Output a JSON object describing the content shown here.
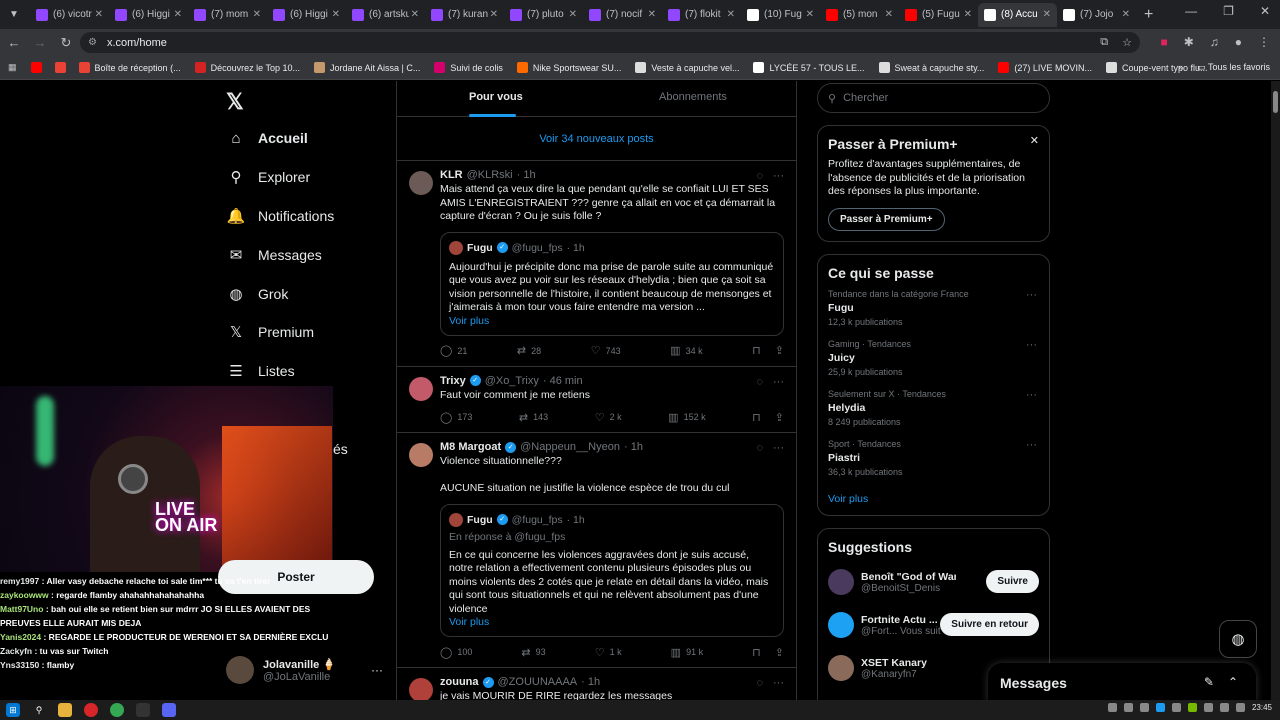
{
  "browser": {
    "tabs": [
      {
        "label": "(6) vicotr",
        "color": "#9147ff"
      },
      {
        "label": "(6) Higgi",
        "color": "#9147ff"
      },
      {
        "label": "(7) mom",
        "color": "#9147ff"
      },
      {
        "label": "(6) Higgi",
        "color": "#9147ff"
      },
      {
        "label": "(6) artsku",
        "color": "#9147ff"
      },
      {
        "label": "(7) kuran",
        "color": "#9147ff"
      },
      {
        "label": "(7) pluto",
        "color": "#9147ff"
      },
      {
        "label": "(7) nocif",
        "color": "#9147ff"
      },
      {
        "label": "(7) flokit",
        "color": "#9147ff"
      },
      {
        "label": "(10) Fug",
        "color": "#ffffff"
      },
      {
        "label": "(5) mon",
        "color": "#ff0000"
      },
      {
        "label": "(5) Fugu",
        "color": "#ff0000"
      },
      {
        "label": "(8) Accu",
        "color": "#ffffff"
      },
      {
        "label": "(7) Jojo",
        "color": "#ffffff"
      }
    ],
    "active_tab_index": 12,
    "url": "x.com/home",
    "bookmarks": [
      {
        "label": "",
        "color": "#ff0000"
      },
      {
        "label": "",
        "color": "#ea4335"
      },
      {
        "label": "Boîte de réception (...",
        "color": "#ea4335"
      },
      {
        "label": "Découvrez le Top 10...",
        "color": "#d32323"
      },
      {
        "label": "Jordane Ait Aissa | C...",
        "color": "#c49a6c"
      },
      {
        "label": "Suivi de colis",
        "color": "#d6006d"
      },
      {
        "label": "Nike Sportswear SU...",
        "color": "#ff6a00"
      },
      {
        "label": "Veste à capuche vel...",
        "color": "#dddddd"
      },
      {
        "label": "LYCÉE 57 - TOUS LE...",
        "color": "#ffffff"
      },
      {
        "label": "Sweat à capuche sty...",
        "color": "#dddddd"
      },
      {
        "label": "(27)  LIVE MOVIN...",
        "color": "#ff0000"
      },
      {
        "label": "Coupe-vent typo flu...",
        "color": "#dddddd"
      }
    ],
    "all_bookmarks": "Tous les favoris"
  },
  "leftnav": {
    "logo": "𝕏",
    "items": [
      {
        "label": "Accueil",
        "icon": "⌂"
      },
      {
        "label": "Explorer",
        "icon": "⚲"
      },
      {
        "label": "Notifications",
        "icon": "🔔"
      },
      {
        "label": "Messages",
        "icon": "✉"
      },
      {
        "label": "Grok",
        "icon": "◍"
      },
      {
        "label": "Premium",
        "icon": "𝕏"
      },
      {
        "label": "Listes",
        "icon": "☰"
      }
    ],
    "partial_label": "és",
    "post_button": "Poster",
    "profile": {
      "name": "Jolavanille 🍦",
      "handle": "@JoLaVanille"
    }
  },
  "stream_chat": [
    {
      "user": "remy1997",
      "color": "#e7e9ea",
      "msg": " : Aller vasy debache relache toi sale tim*** tu va t'en tirer"
    },
    {
      "user": "zaykoowww",
      "color": "#a9e37a",
      "msg": " : regarde flamby ahahahhahahahahha"
    },
    {
      "user": "Matt97Uno",
      "color": "#a9e37a",
      "msg": " : bah oui elle se retient bien sur mdrrr JO SI ELLES AVAIENT DES"
    },
    {
      "user": "",
      "color": "#fff",
      "msg": "PREUVES ELLE AURAIT MIS DEJA"
    },
    {
      "user": "Yanis2024",
      "color": "#a9e37a",
      "msg": " : REGARDE LE PRODUCTEUR DE WERENOI ET SA DERNIÈRE EXCLU"
    },
    {
      "user": "Zackyfn",
      "color": "#e7e9ea",
      "msg": " : tu vas sur Twitch"
    },
    {
      "user": "Yns33150",
      "color": "#e7e9ea",
      "msg": " : flamby"
    }
  ],
  "timeline": {
    "tabs": [
      "Pour vous",
      "Abonnements"
    ],
    "new_posts": "Voir 34 nouveaux posts",
    "tweets": [
      {
        "name": "KLR",
        "handle": "@KLRski",
        "time": "· 1h",
        "verified": false,
        "avatar_color": "#6b5a55",
        "text": "Mais attend ça veux dire la que pendant qu'elle se confiait LUI ET SES AMIS L'ENREGISTRAIENT ??? genre ça allait en voc et ça démarrait la capture d'écran ? Ou je suis folle ?",
        "quote": {
          "name": "Fugu",
          "handle": "@fugu_fps",
          "time": "· 1h",
          "reply_to": "",
          "text": "Aujourd'hui je précipite donc ma prise de parole suite au communiqué que vous avez pu voir sur les réseaux d'helydia ; bien que ça soit sa vision personnelle de l'histoire, il contient beaucoup de mensonges et j'aimerais à mon tour vous faire entendre ma version ...",
          "more": "Voir plus"
        },
        "stats": {
          "replies": "21",
          "reposts": "28",
          "likes": "743",
          "views": "34 k"
        }
      },
      {
        "name": "Trixy",
        "handle": "@Xo_Trixy",
        "time": "· 46 min",
        "verified": true,
        "avatar_color": "#c25a6a",
        "text": "Faut voir comment je me retiens",
        "stats": {
          "replies": "173",
          "reposts": "143",
          "likes": "2 k",
          "views": "152 k"
        }
      },
      {
        "name": "M8 Margoat",
        "handle": "@Nappeun__Nyeon",
        "time": "· 1h",
        "verified": true,
        "avatar_color": "#b87c66",
        "text": "Violence situationnelle???\n\nAUCUNE situation ne justifie la violence espèce de trou du cul",
        "quote": {
          "name": "Fugu",
          "handle": "@fugu_fps",
          "time": "· 1h",
          "reply_to": "En réponse à @fugu_fps",
          "text": "En ce qui concerne les violences aggravées dont je suis accusé, notre relation a effectivement contenu plusieurs épisodes plus ou moins violents des 2 cotés que je relate en détail dans la vidéo, mais qui sont tous situationnels et qui ne relèvent absolument pas d'une violence",
          "more": "Voir plus"
        },
        "stats": {
          "replies": "100",
          "reposts": "93",
          "likes": "1 k",
          "views": "91 k"
        }
      },
      {
        "name": "zouuna",
        "handle": "@ZOUUNAAAA",
        "time": "· 1h",
        "verified": true,
        "avatar_color": "#b0403a",
        "text": "je vais MOURIR DE RIRE regardez les messages"
      }
    ]
  },
  "rightcol": {
    "search_placeholder": "Chercher",
    "premium": {
      "title": "Passer à Premium+",
      "text": "Profitez d'avantages supplémentaires, de l'absence de publicités et de la priorisation des réponses la plus importante.",
      "button": "Passer à Premium+"
    },
    "happening": {
      "title": "Ce qui se passe",
      "trends": [
        {
          "meta": "Tendance dans la catégorie France",
          "name": "Fugu",
          "count": "12,3 k publications"
        },
        {
          "meta": "Gaming · Tendances",
          "name": "Juicy",
          "count": "25,9 k publications"
        },
        {
          "meta": "Seulement sur X · Tendances",
          "name": "Helydia",
          "count": "8 249 publications"
        },
        {
          "meta": "Sport · Tendances",
          "name": "Piastri",
          "count": "36,3 k publications"
        }
      ],
      "more": "Voir plus"
    },
    "suggestions": {
      "title": "Suggestions",
      "people": [
        {
          "name": "Benoît \"God of War\" Sa...",
          "handle": "@BenoitSt_Denis",
          "button": "Suivre",
          "color": "#4a3a5e"
        },
        {
          "name": "Fortnite Actu ...",
          "handle": "@Fort...  Vous suit",
          "button": "Suivre en retour",
          "color": "#1da1f2"
        },
        {
          "name": "XSET Kanary",
          "handle": "@Kanaryfn7",
          "button": "",
          "color": "#8a6a5a"
        }
      ]
    },
    "messages_drawer": "Messages"
  },
  "taskbar": {
    "clock": "23:45"
  }
}
